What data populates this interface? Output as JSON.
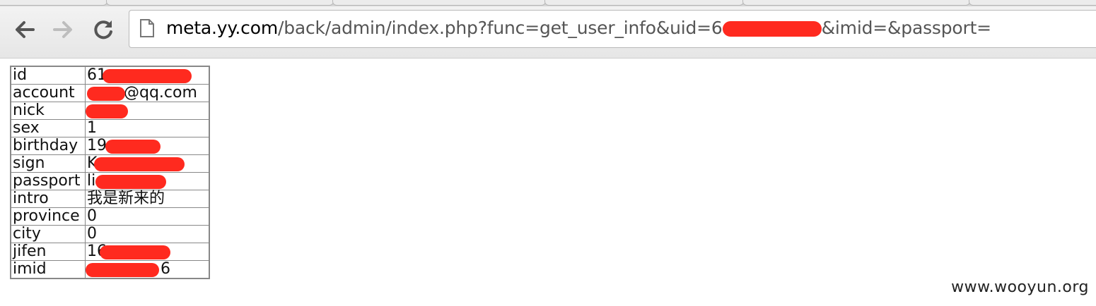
{
  "toolbar": {
    "back_icon": "arrow-left-icon",
    "forward_icon": "arrow-right-icon",
    "reload_icon": "reload-icon",
    "page_icon": "document-icon"
  },
  "address_bar": {
    "host": "meta.yy.com",
    "path_before_redaction": "/back/admin/index.php?func=get_user_info&uid=6",
    "path_after_redaction": "&imid=&passport="
  },
  "user_info": [
    {
      "key": "id",
      "value": "61"
    },
    {
      "key": "account",
      "value": "@qq.com"
    },
    {
      "key": "nick",
      "value": ""
    },
    {
      "key": "sex",
      "value": "1"
    },
    {
      "key": "birthday",
      "value": "19"
    },
    {
      "key": "sign",
      "value": "K"
    },
    {
      "key": "passport",
      "value": "li"
    },
    {
      "key": "intro",
      "value": "我是新来的"
    },
    {
      "key": "province",
      "value": "0"
    },
    {
      "key": "city",
      "value": "0"
    },
    {
      "key": "jifen",
      "value": "16"
    },
    {
      "key": "imid",
      "value": "6"
    }
  ],
  "watermark": "www.wooyun.org",
  "colors": {
    "redaction": "#ff2a1f"
  }
}
